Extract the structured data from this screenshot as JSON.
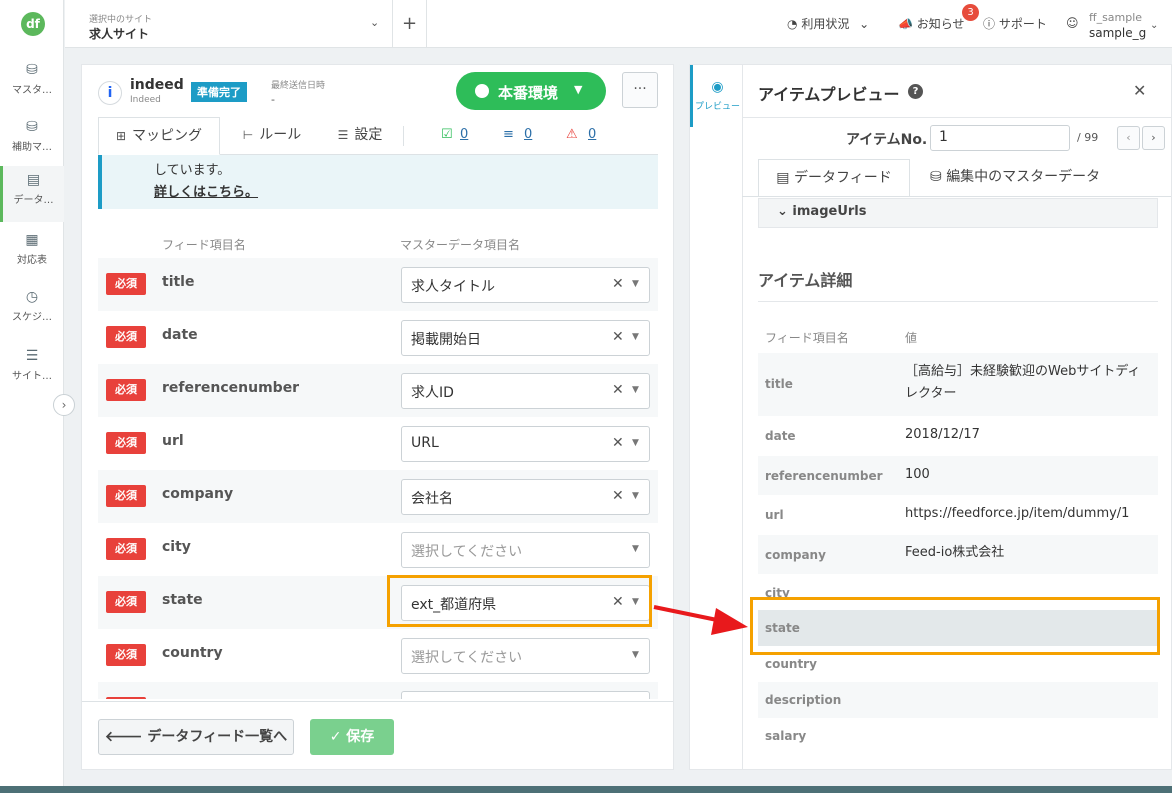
{
  "nav": {
    "logo": "df",
    "items": [
      {
        "label": "マスタ…",
        "icon": "database-icon"
      },
      {
        "label": "補助マ…",
        "icon": "database-plus-icon"
      },
      {
        "label": "データ…",
        "icon": "document-icon"
      },
      {
        "label": "対応表",
        "icon": "table-icon"
      },
      {
        "label": "スケジ…",
        "icon": "schedule-icon"
      },
      {
        "label": "サイト…",
        "icon": "sliders-icon"
      }
    ],
    "collapse": "›"
  },
  "header": {
    "site_small": "選択中のサイト",
    "site_name": "求人サイト",
    "add": "+",
    "usage": "利用状況",
    "notices": "お知らせ",
    "notice_count": "3",
    "support": "サポート",
    "user_small": "ff_sample",
    "user_name": "sample_g"
  },
  "feed": {
    "icon": "i",
    "name": "indeed",
    "sub": "Indeed",
    "status": "準備完了",
    "last_sent_label": "最終送信日時",
    "last_sent_value": "-",
    "env_label": "本番環境",
    "more": "···"
  },
  "tabs": {
    "mapping": "マッピング",
    "rules": "ルール",
    "settings": "設定",
    "ok_count": "0",
    "x_count": "0",
    "warn_count": "0"
  },
  "info": {
    "text": "しています。",
    "link": "詳しくはこちら。"
  },
  "columns": {
    "feed_item": "フィード項目名",
    "master_item": "マスターデータ項目名"
  },
  "required_label": "必須",
  "mappings": [
    {
      "field": "title",
      "value": "求人タイトル",
      "placeholder": false
    },
    {
      "field": "date",
      "value": "掲載開始日",
      "placeholder": false
    },
    {
      "field": "referencenumber",
      "value": "求人ID",
      "placeholder": false
    },
    {
      "field": "url",
      "value": "URL",
      "placeholder": false
    },
    {
      "field": "company",
      "value": "会社名",
      "placeholder": false
    },
    {
      "field": "city",
      "value": "選択してください",
      "placeholder": true
    },
    {
      "field": "state",
      "value": "ext_都道府県",
      "placeholder": false
    },
    {
      "field": "country",
      "value": "選択してください",
      "placeholder": true
    }
  ],
  "footer": {
    "back": "データフィード一覧へ",
    "save": "保存"
  },
  "preview": {
    "side_tab": "プレビュー",
    "title": "アイテムプレビュー",
    "item_no_label": "アイテムNo.",
    "item_no_value": "1",
    "item_total": "/ 99",
    "tab_feed": "データフィード",
    "tab_master": "編集中のマスターデータ",
    "imageurls": "imageUrls",
    "detail_title": "アイテム詳細",
    "col_name": "フィード項目名",
    "col_value": "値",
    "rows": [
      {
        "name": "title",
        "value": "［高給与］未経験歓迎のWebサイトディレクター"
      },
      {
        "name": "date",
        "value": "2018/12/17"
      },
      {
        "name": "referencenumber",
        "value": "100"
      },
      {
        "name": "url",
        "value": "https://feedforce.jp/item/dummy/1"
      },
      {
        "name": "company",
        "value": "Feed-io株式会社"
      },
      {
        "name": "city",
        "value": ""
      },
      {
        "name": "state",
        "value": ""
      },
      {
        "name": "country",
        "value": ""
      },
      {
        "name": "description",
        "value": ""
      },
      {
        "name": "salary",
        "value": ""
      }
    ]
  },
  "colors": {
    "accent_green": "#2ebd59",
    "required_red": "#e8413b",
    "highlight_orange": "#f5a100",
    "info_blue": "#1d9cc6"
  }
}
